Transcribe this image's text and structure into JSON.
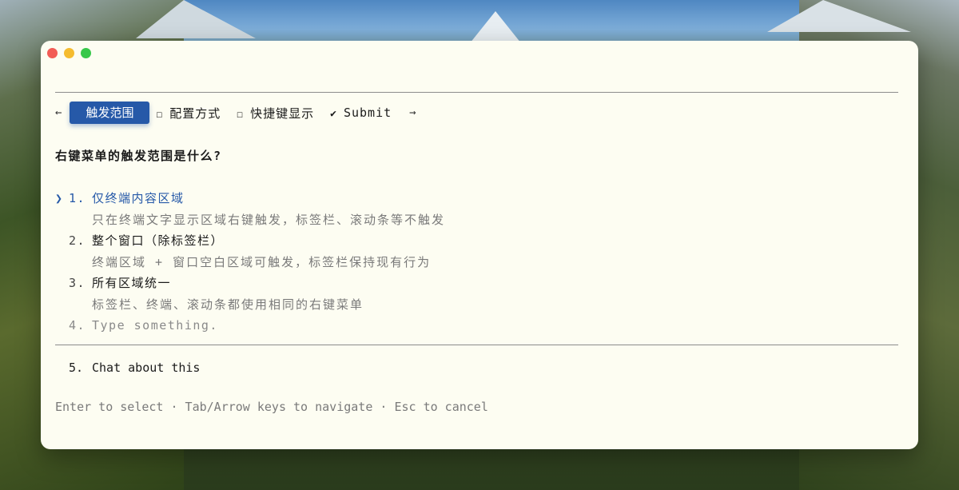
{
  "window": {
    "controls": [
      "close",
      "minimize",
      "zoom"
    ]
  },
  "tabs": {
    "prev_arrow": "←",
    "next_arrow": "→",
    "items": [
      {
        "label": "触发范围",
        "state": "active",
        "marker": ""
      },
      {
        "label": "配置方式",
        "state": "unchecked",
        "marker": "☐"
      },
      {
        "label": "快捷键显示",
        "state": "unchecked",
        "marker": "☐"
      },
      {
        "label": "Submit",
        "state": "checked",
        "marker": "✔"
      }
    ]
  },
  "question": "右键菜单的触发范围是什么?",
  "pointer": "❯",
  "options": [
    {
      "number": "1.",
      "label": "仅终端内容区域",
      "description": "只在终端文字显示区域右键触发，标签栏、滚动条等不触发",
      "selected": true
    },
    {
      "number": "2.",
      "label": "整个窗口（除标签栏）",
      "description": "终端区域 + 窗口空白区域可触发，标签栏保持现有行为",
      "selected": false
    },
    {
      "number": "3.",
      "label": "所有区域统一",
      "description": "标签栏、终端、滚动条都使用相同的右键菜单",
      "selected": false
    },
    {
      "number": "4.",
      "label": "Type something.",
      "description": "",
      "selected": false
    }
  ],
  "chat": {
    "number": "5.",
    "label": "Chat about this"
  },
  "footer": "Enter to select · Tab/Arrow keys to navigate · Esc to cancel",
  "colors": {
    "accent": "#2659a8",
    "window_bg": "#fdfdf2",
    "muted_text": "#7a7a7a",
    "close": "#f25c56",
    "minimize": "#f5bc2f",
    "zoom": "#37c84a"
  }
}
